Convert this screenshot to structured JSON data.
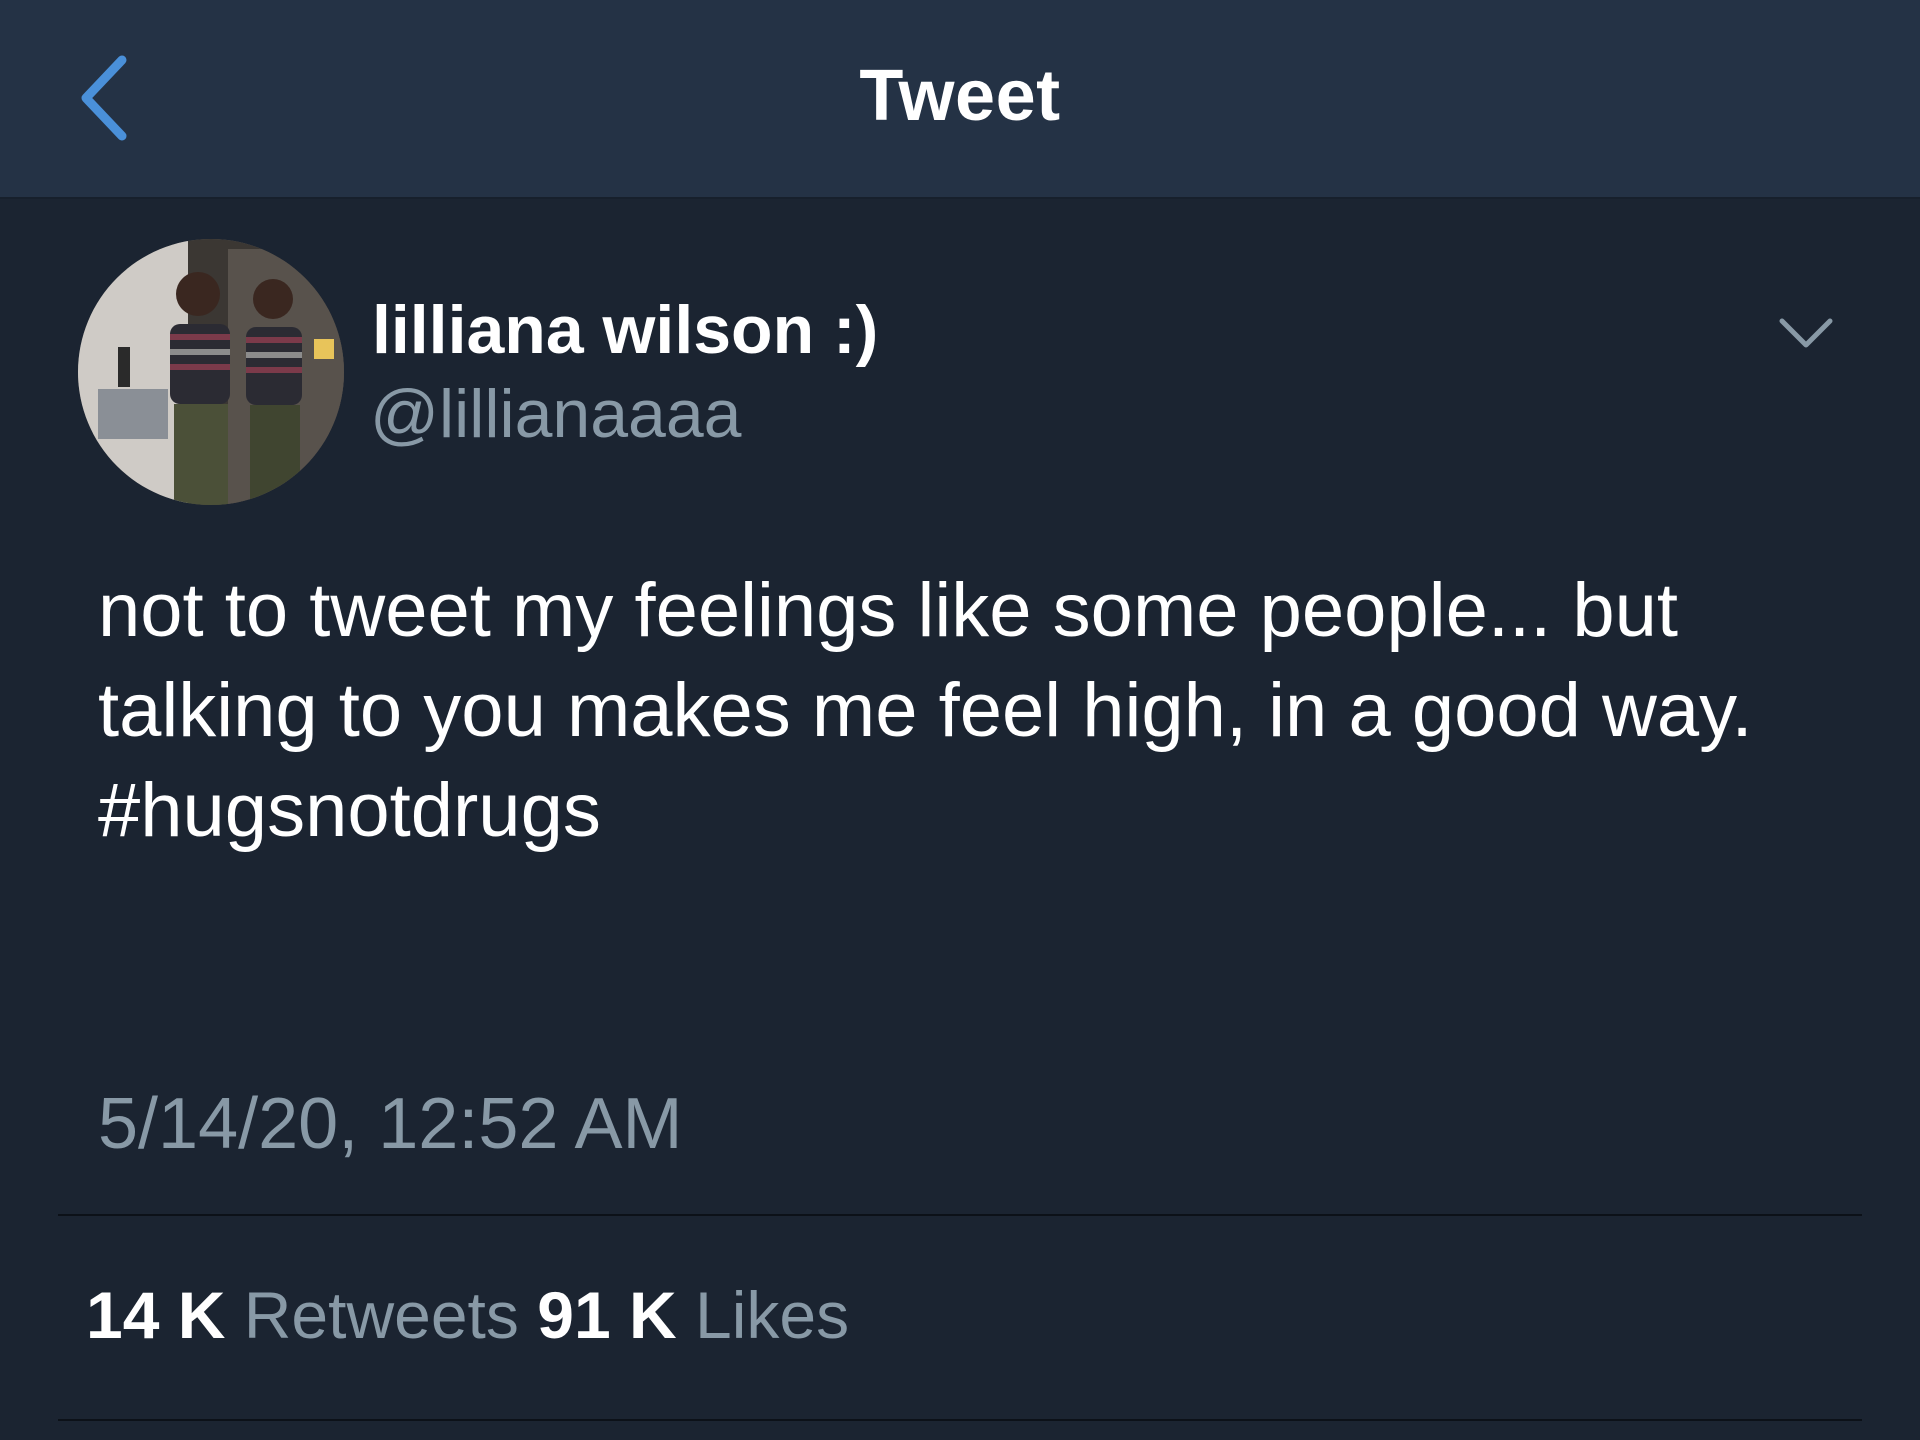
{
  "header": {
    "title": "Tweet",
    "back_icon": "chevron-left-icon",
    "accent_color": "#4a90d9"
  },
  "tweet": {
    "display_name": "lilliana wilson :)",
    "handle": "@lillianaaaa",
    "avatar": "profile-photo",
    "more_icon": "chevron-down-icon",
    "text": "not to tweet my feelings like some people... but talking to you makes me feel high, in a good way. #hugsnotdrugs",
    "timestamp": "5/14/20, 12:52 AM"
  },
  "stats": {
    "retweets_count": "14 K",
    "retweets_label": "Retweets",
    "likes_count": "91 K",
    "likes_label": "Likes"
  },
  "colors": {
    "background": "#1b2431",
    "nav_background": "#243245",
    "secondary_text": "#8899a6"
  }
}
